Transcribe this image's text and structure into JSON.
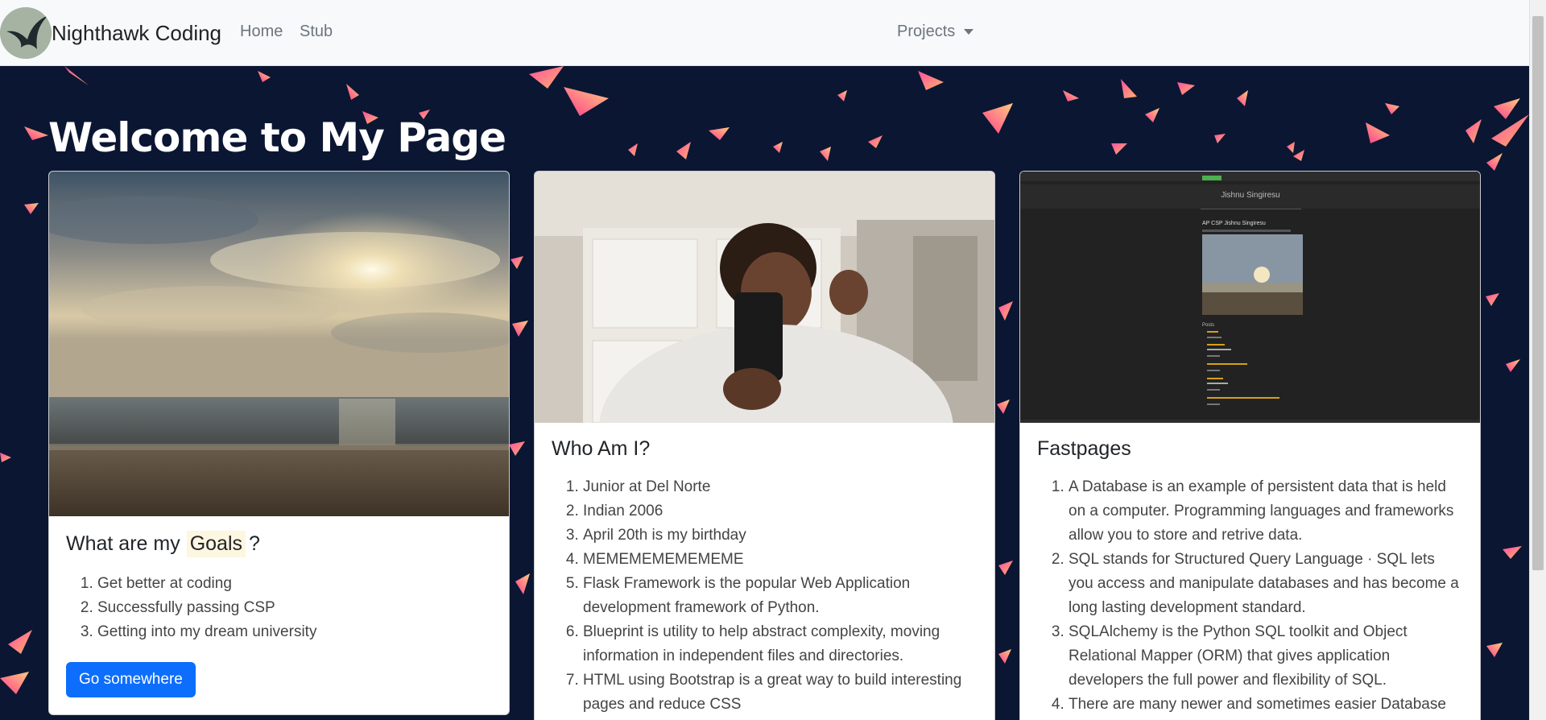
{
  "navbar": {
    "brand": "Nighthawk Coding",
    "links": [
      {
        "label": "Home"
      },
      {
        "label": "Stub"
      }
    ],
    "dropdown_label": "Projects"
  },
  "page": {
    "title": "Welcome to My Page"
  },
  "cards": [
    {
      "title_prefix": "What are my",
      "title_highlight": "Goals",
      "title_suffix": "?",
      "items": [
        "Get better at coding",
        "Successfully passing CSP",
        "Getting into my dream university"
      ],
      "button": "Go somewhere"
    },
    {
      "title": "Who Am I?",
      "items": [
        "Junior at Del Norte",
        "Indian 2006",
        "April 20th is my birthday",
        "MEMEMEMEMEMEME",
        "Flask Framework is the popular Web Application development framework of Python.",
        "Blueprint is utility to help abstract complexity, moving information in independent files and directories.",
        "HTML using Bootstrap is a great way to build interesting pages and reduce CSS"
      ]
    },
    {
      "title": "Fastpages",
      "items": [
        "A Database is an example of persistent data that is held on a computer. Programming languages and frameworks allow you to store and retrive data.",
        "SQL stands for Structured Query Language · SQL lets you access and manipulate databases and has become a long lasting development standard.",
        "SQLAlchemy is the Python SQL toolkit and Object Relational Mapper (ORM) that gives application developers the full power and flexibility of SQL.",
        "There are many newer and sometimes easier Database"
      ],
      "screenshot": {
        "header": "Jishnu Singiresu",
        "post_title": "AP CSP Jishnu Singiresu",
        "posts_heading": "Posts"
      }
    }
  ],
  "colors": {
    "background": "#0b1633",
    "navbar": "#f8f9fa",
    "primary": "#0d6efd",
    "confetti_pink": "#ff5fa2",
    "confetti_orange": "#ffb36b"
  }
}
